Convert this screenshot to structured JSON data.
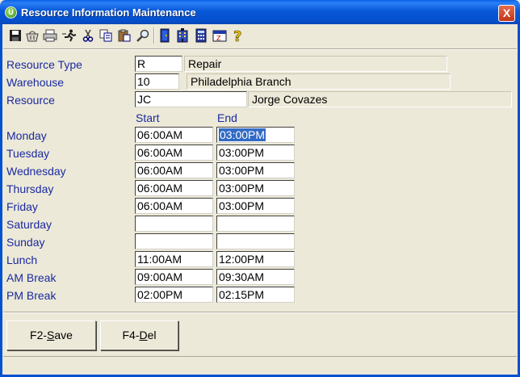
{
  "window": {
    "title": "Resource Information Maintenance",
    "close_label": "X"
  },
  "toolbar": {
    "icons": [
      "save-icon",
      "basket-icon",
      "print-icon",
      "run-icon",
      "cut-icon",
      "copy-icon",
      "paste-icon",
      "find-icon",
      "exit-door-icon",
      "building-icon",
      "calculator-icon",
      "calendar-icon",
      "help-icon"
    ]
  },
  "form": {
    "resource_type": {
      "label": "Resource Type",
      "code": "R",
      "description": "Repair"
    },
    "warehouse": {
      "label": "Warehouse",
      "code": "10",
      "description": "Philadelphia Branch"
    },
    "resource": {
      "label": "Resource",
      "code": "JC",
      "description": "Jorge Covazes"
    }
  },
  "schedule": {
    "start_header": "Start",
    "end_header": "End",
    "rows": [
      {
        "label": "Monday",
        "start": "06:00AM",
        "end": "03:00PM"
      },
      {
        "label": "Tuesday",
        "start": "06:00AM",
        "end": "03:00PM"
      },
      {
        "label": "Wednesday",
        "start": "06:00AM",
        "end": "03:00PM"
      },
      {
        "label": "Thursday",
        "start": "06:00AM",
        "end": "03:00PM"
      },
      {
        "label": "Friday",
        "start": "06:00AM",
        "end": "03:00PM"
      },
      {
        "label": "Saturday",
        "start": "",
        "end": ""
      },
      {
        "label": "Sunday",
        "start": "",
        "end": ""
      },
      {
        "label": "Lunch",
        "start": "11:00AM",
        "end": "12:00PM"
      },
      {
        "label": "AM Break",
        "start": "09:00AM",
        "end": "09:30AM"
      },
      {
        "label": "PM Break",
        "start": "02:00PM",
        "end": "02:15PM"
      }
    ]
  },
  "buttons": {
    "save": {
      "prefix": "F2-",
      "hotkey": "S",
      "rest": "ave"
    },
    "delete": {
      "prefix": "F4-",
      "hotkey": "D",
      "rest": "el"
    }
  },
  "colors": {
    "label": "#1b2aa0",
    "titlebar": "#0858d8",
    "selection": "#316ac5"
  }
}
